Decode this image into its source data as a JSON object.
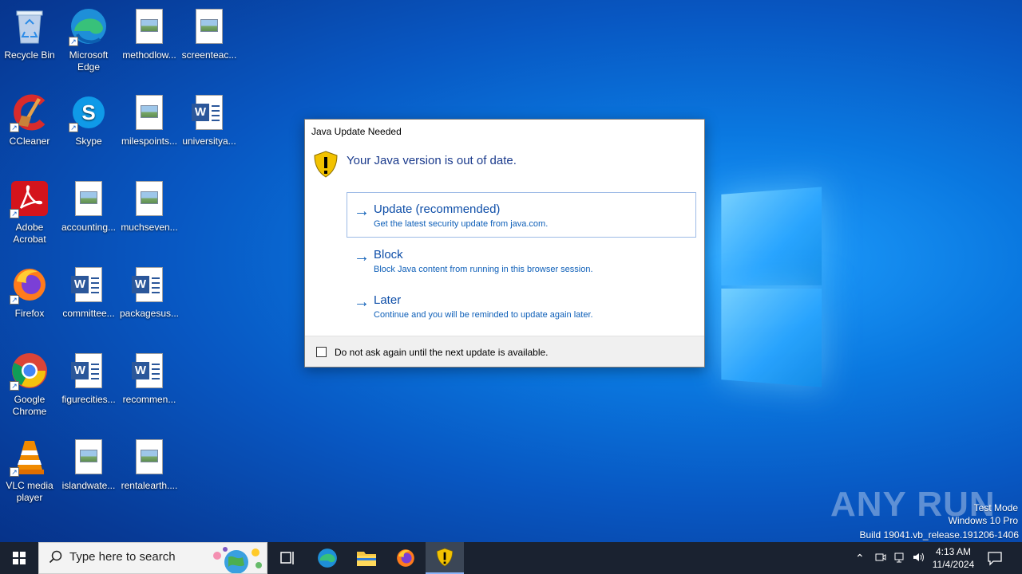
{
  "desktop": {
    "icons": [
      {
        "label": "Recycle Bin",
        "icon": "recycle-bin-icon"
      },
      {
        "label": "Microsoft Edge",
        "icon": "edge-icon"
      },
      {
        "label": "methodlow...",
        "icon": "image-file-icon"
      },
      {
        "label": "screenteac...",
        "icon": "image-file-icon"
      },
      {
        "label": "CCleaner",
        "icon": "ccleaner-icon"
      },
      {
        "label": "Skype",
        "icon": "skype-icon"
      },
      {
        "label": "milespoints...",
        "icon": "image-file-icon"
      },
      {
        "label": "universitya...",
        "icon": "word-doc-icon"
      },
      {
        "label": "Adobe Acrobat",
        "icon": "acrobat-icon"
      },
      {
        "label": "accounting...",
        "icon": "image-file-icon"
      },
      {
        "label": "muchseven...",
        "icon": "image-file-icon"
      },
      {
        "label": "Firefox",
        "icon": "firefox-icon"
      },
      {
        "label": "committee...",
        "icon": "word-doc-icon"
      },
      {
        "label": "packagesus...",
        "icon": "word-doc-icon"
      },
      {
        "label": "Google Chrome",
        "icon": "chrome-icon"
      },
      {
        "label": "figurecities...",
        "icon": "word-doc-icon"
      },
      {
        "label": "recommen...",
        "icon": "word-doc-icon"
      },
      {
        "label": "VLC media player",
        "icon": "vlc-icon"
      },
      {
        "label": "islandwate...",
        "icon": "image-file-icon"
      },
      {
        "label": "rentalearth....",
        "icon": "image-file-icon"
      }
    ]
  },
  "dialog": {
    "title": "Java Update Needed",
    "heading": "Your Java version is out of date.",
    "options": [
      {
        "title": "Update (recommended)",
        "desc": "Get the latest security update from java.com."
      },
      {
        "title": "Block",
        "desc": "Block Java content from running in this browser session."
      },
      {
        "title": "Later",
        "desc": "Continue and you will be reminded to update again later."
      }
    ],
    "checkbox_label": "Do not ask again until the next update is available.",
    "checkbox_checked": false
  },
  "watermark": {
    "logo": "ANY RUN",
    "line1": "Test Mode",
    "line2": "Windows 10 Pro",
    "line3": "Build 19041.vb_release.191206-1406"
  },
  "taskbar": {
    "search_placeholder": "Type here to search",
    "time": "4:13 AM",
    "date": "11/4/2024"
  },
  "colors": {
    "accent": "#0e5fb8",
    "taskbar": "#1a2230",
    "java_shield": "#f2c200"
  }
}
